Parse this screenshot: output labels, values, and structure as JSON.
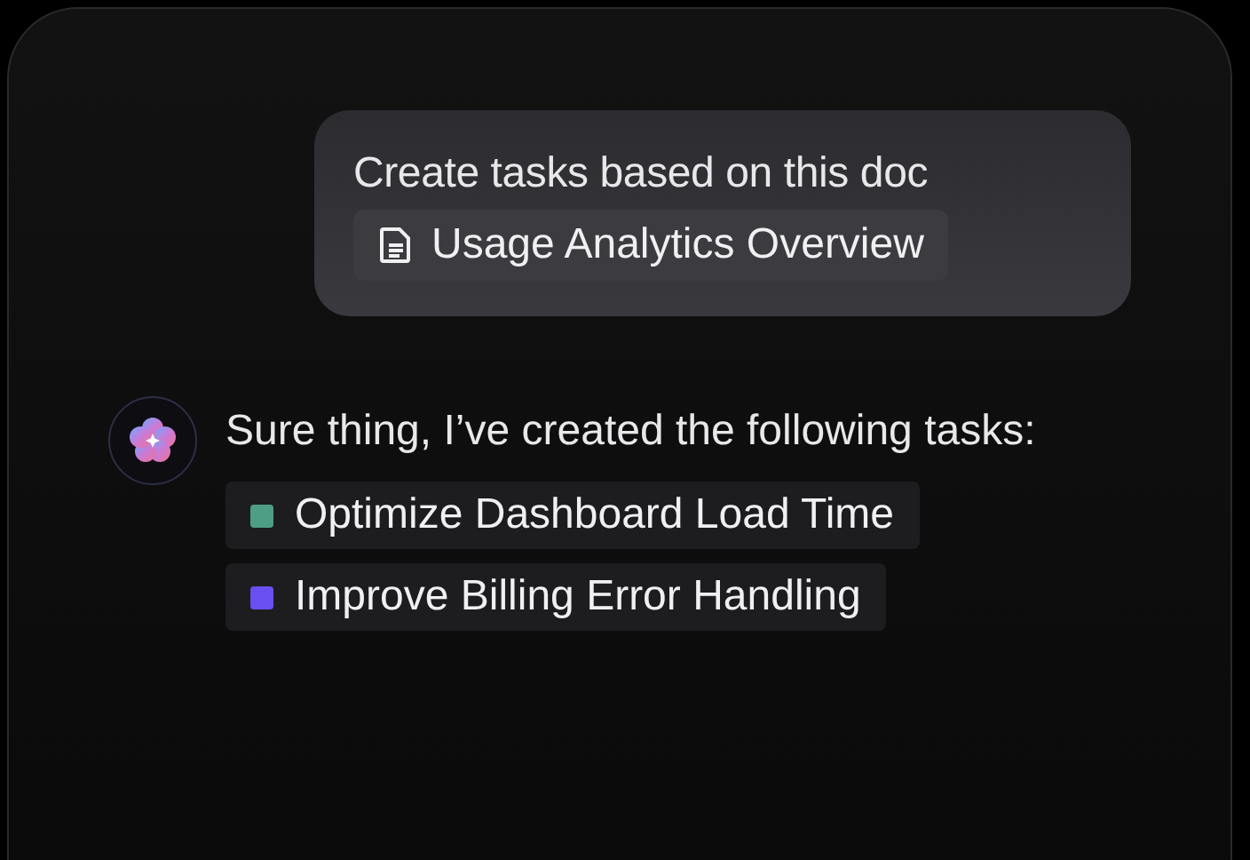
{
  "user_message": {
    "text": "Create tasks based on this doc",
    "attachment": "Usage Analytics Overview"
  },
  "assistant_message": {
    "text": "Sure thing, I’ve created the following tasks:",
    "tasks": [
      {
        "label": "Optimize Dashboard Load Time",
        "color": "#4e9e86"
      },
      {
        "label": "Improve Billing Error Handling",
        "color": "#6a4ff0"
      }
    ]
  }
}
